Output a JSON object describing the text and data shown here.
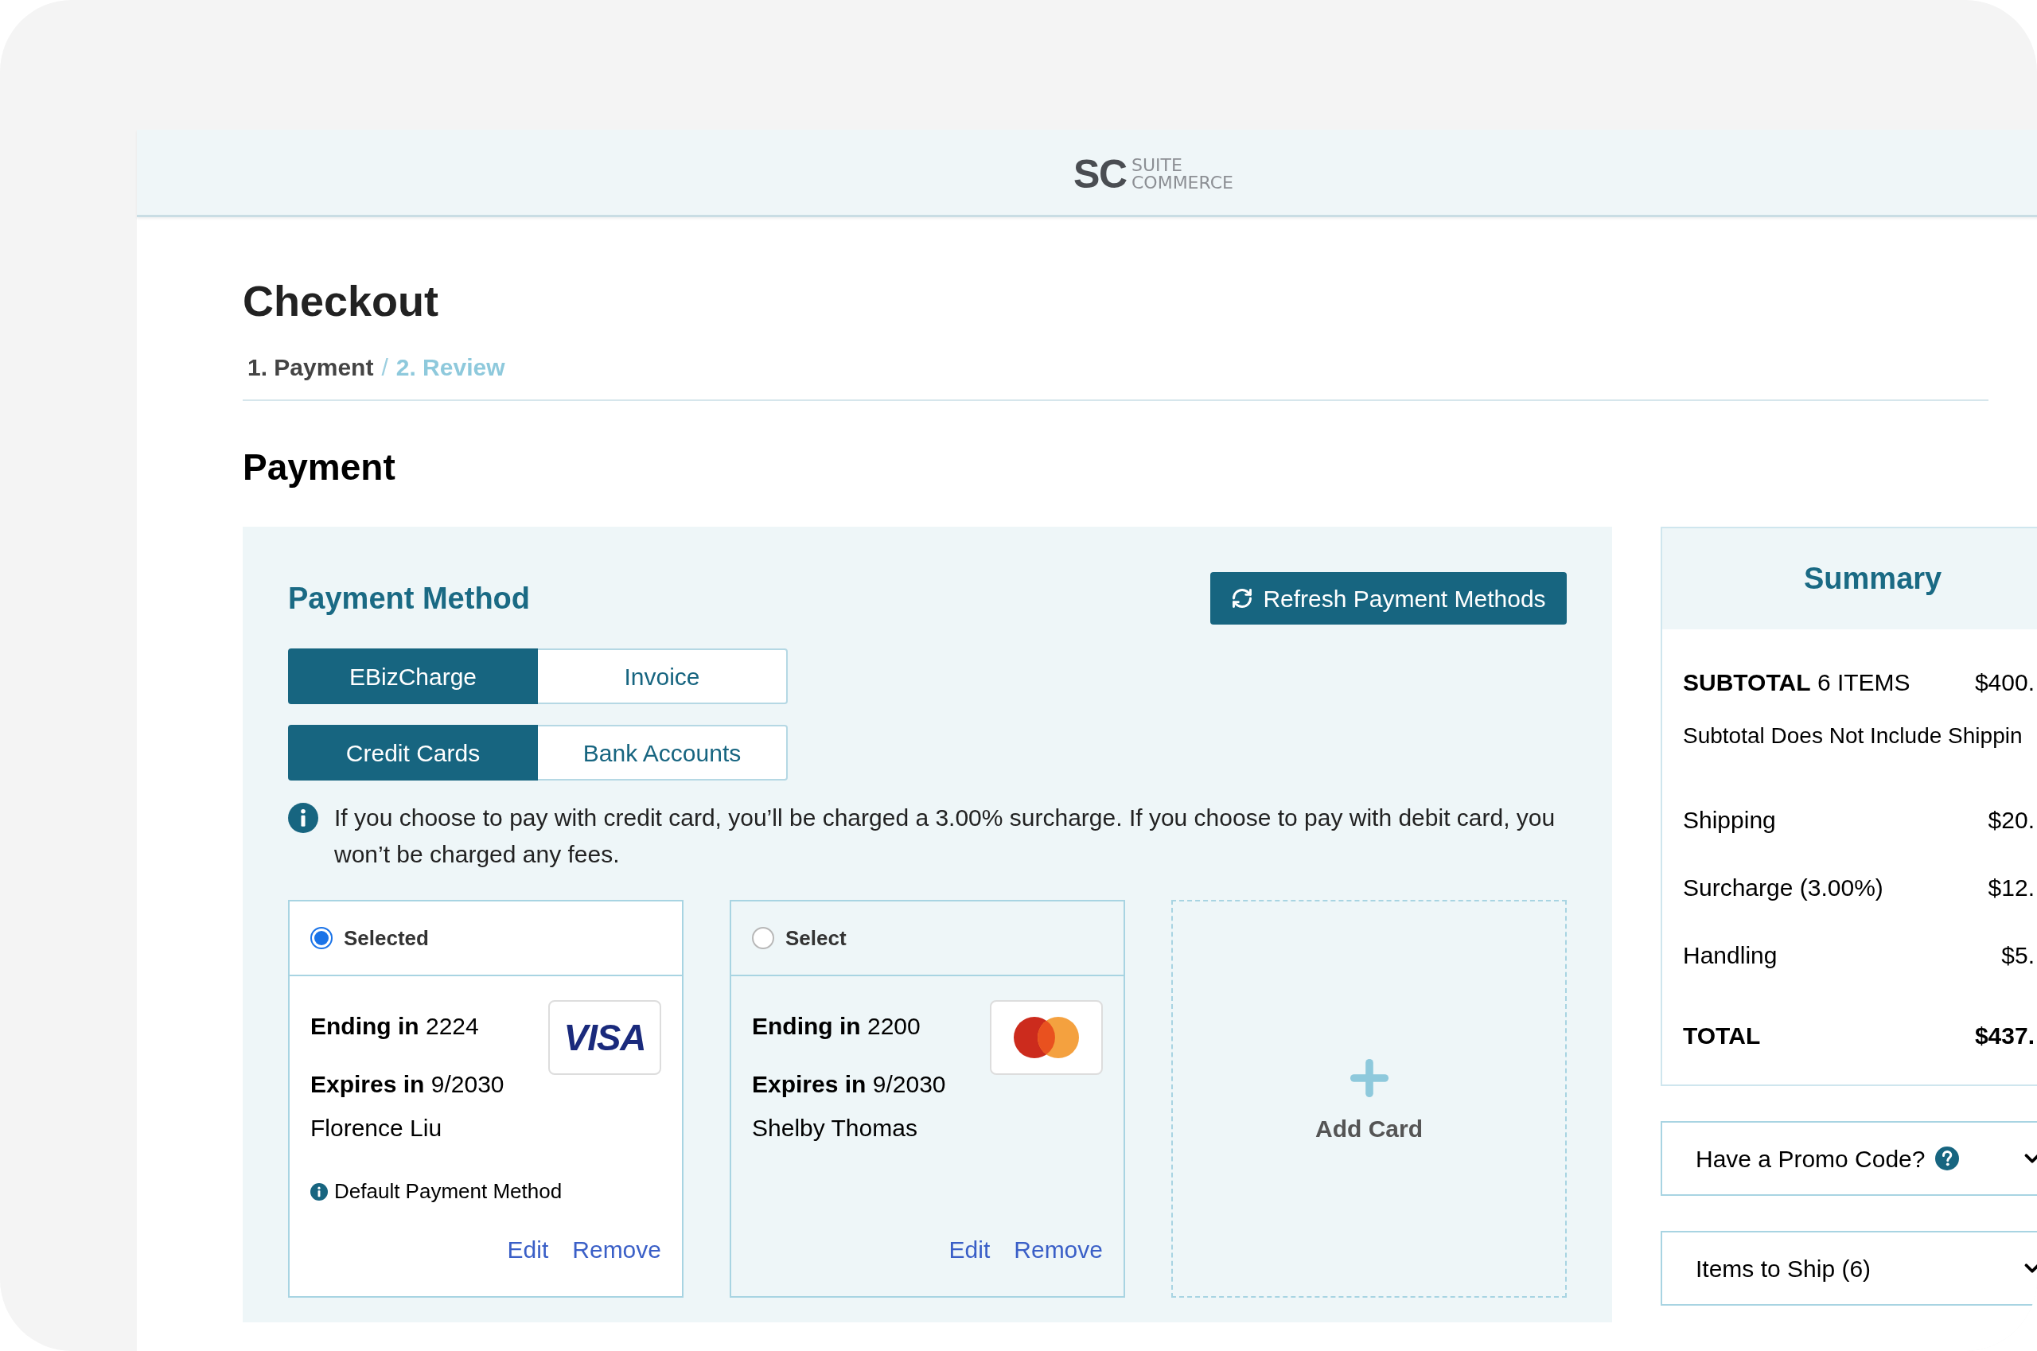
{
  "header": {
    "logo": {
      "mark": "SC",
      "line1": "SUITE",
      "line2": "COMMERCE"
    }
  },
  "title": "Checkout",
  "breadcrumb": {
    "separator": "/",
    "steps": [
      {
        "label": "1. Payment",
        "selected": true
      },
      {
        "label": "2. Review",
        "selected": false
      }
    ]
  },
  "section_title": "Payment",
  "payment_method": {
    "title": "Payment Method",
    "refresh_button": "Refresh Payment Methods",
    "gateway_tabs": [
      {
        "label": "EBizCharge",
        "selected": true
      },
      {
        "label": "Invoice",
        "selected": false
      }
    ],
    "type_tabs": [
      {
        "label": "Credit Cards",
        "selected": true
      },
      {
        "label": "Bank Accounts",
        "selected": false
      }
    ],
    "notice": "If you choose to pay with credit card, you’ll be charged a 3.00% surcharge. If you choose to pay with debit card, you won’t be charged any fees.",
    "cards": [
      {
        "selected": true,
        "radio_label": "Selected",
        "ending_label": "Ending in",
        "ending": "2224",
        "expires_label": "Expires in",
        "expires": "9/2030",
        "name": "Florence Liu",
        "kind": "visa",
        "brand_text": "VISA",
        "default_note": "Default Payment Method",
        "actions": [
          "Edit",
          "Remove"
        ]
      },
      {
        "selected": false,
        "radio_label": "Select",
        "ending_label": "Ending in",
        "ending": "2200",
        "expires_label": "Expires in",
        "expires": "9/2030",
        "name": "Shelby Thomas",
        "kind": "mastercard",
        "actions": [
          "Edit",
          "Remove"
        ]
      }
    ],
    "add_card": "Add Card"
  },
  "summary": {
    "title": "Summary",
    "subtotal": {
      "label": "SUBTOTAL",
      "count": "6 ITEMS",
      "value": "$400."
    },
    "note": "Subtotal Does Not Include Shippin",
    "lines": [
      {
        "label": "Shipping",
        "value": "$20."
      },
      {
        "label": "Surcharge (3.00%)",
        "value": "$12."
      },
      {
        "label": "Handling",
        "value": "$5."
      }
    ],
    "total": {
      "label": "TOTAL",
      "value": "$437."
    }
  },
  "panels": [
    {
      "label": "Have a Promo Code?",
      "help": true
    },
    {
      "label": "Items to Ship (6)",
      "help": false
    }
  ]
}
